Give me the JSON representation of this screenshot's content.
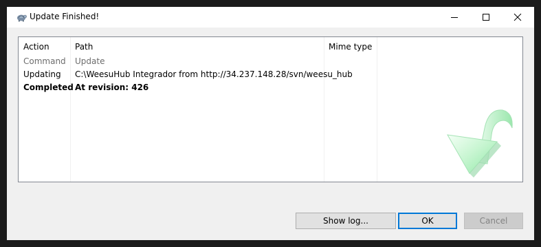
{
  "window": {
    "title": "Update Finished!"
  },
  "icons": {
    "app": "tortoise-app-icon",
    "minimize": "minimize-icon",
    "maximize": "maximize-icon",
    "close": "close-icon",
    "status_graphic": "update-arrow-icon"
  },
  "list": {
    "columns": [
      "Action",
      "Path",
      "Mime type"
    ],
    "rows": [
      {
        "action": "Command",
        "path": "Update"
      },
      {
        "action": "Updating",
        "path": "C:\\WeesuHub Integrador from http://34.237.148.28/svn/weesu_hub"
      },
      {
        "action": "Completed",
        "path": "At revision: 426"
      }
    ]
  },
  "buttons": {
    "show_log": "Show log...",
    "ok": "OK",
    "cancel": "Cancel"
  },
  "colors": {
    "accent": "#0078d7",
    "command_row_text": "#6d6d6d",
    "arrow_green": "#8fe8a6"
  }
}
